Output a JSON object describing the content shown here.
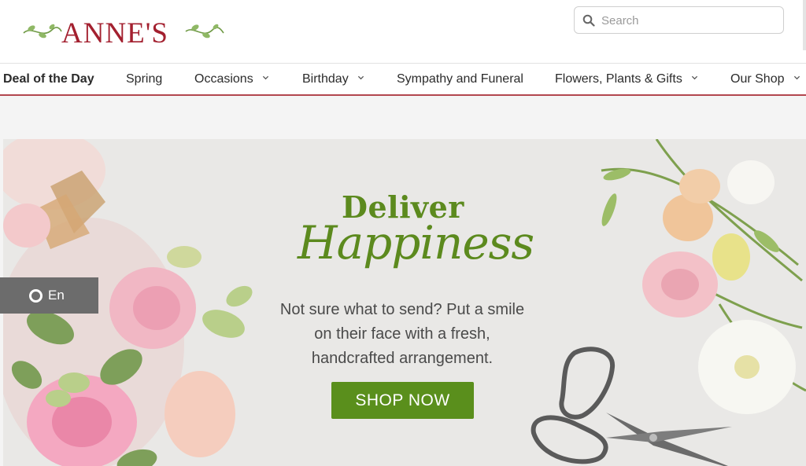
{
  "brand": {
    "name": "ANNE'S",
    "color": "#a3202f"
  },
  "search": {
    "placeholder": "Search",
    "icon": "magnifier-icon"
  },
  "nav": {
    "items": [
      {
        "label": "Deal of the Day",
        "dropdown": false
      },
      {
        "label": "Spring",
        "dropdown": false
      },
      {
        "label": "Occasions",
        "dropdown": true
      },
      {
        "label": "Birthday",
        "dropdown": true
      },
      {
        "label": "Sympathy and Funeral",
        "dropdown": false
      },
      {
        "label": "Flowers, Plants & Gifts",
        "dropdown": true
      },
      {
        "label": "Our Shop",
        "dropdown": true
      }
    ],
    "accent_color": "#b2464e"
  },
  "banner": {
    "headline_line1": "Deliver",
    "headline_line2": "Happiness",
    "body": "Not sure what to send? Put a smile on their face with a fresh, handcrafted arrangement.",
    "cta_label": "SHOP NOW",
    "accent_color": "#5a8f1c"
  },
  "language_widget": {
    "label": "En",
    "icon": "circle-icon"
  }
}
